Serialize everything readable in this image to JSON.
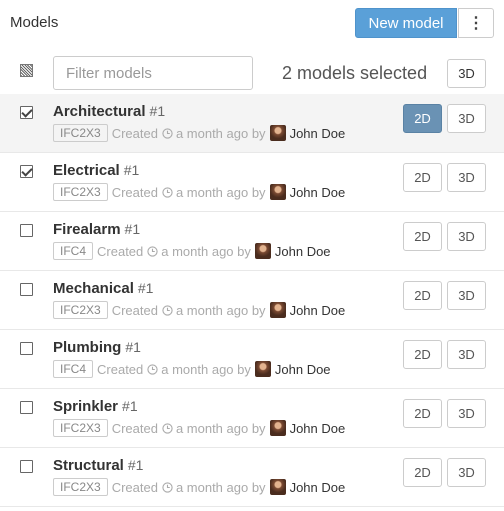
{
  "header": {
    "title": "Models",
    "new_model_label": "New model",
    "more_label": "⋮"
  },
  "toolbar": {
    "filter_placeholder": "Filter models",
    "selected_text": "2 models selected",
    "button_3d": "3D"
  },
  "meta": {
    "created_label": "Created",
    "time_label": "a month ago by",
    "author": "John Doe"
  },
  "models": [
    {
      "name": "Architectural",
      "num": "#1",
      "schema": "IFC2X3",
      "checked": true,
      "active2d": true,
      "btn2d": "2D",
      "btn3d": "3D"
    },
    {
      "name": "Electrical",
      "num": "#1",
      "schema": "IFC2X3",
      "checked": true,
      "active2d": false,
      "btn2d": "2D",
      "btn3d": "3D"
    },
    {
      "name": "Firealarm",
      "num": "#1",
      "schema": "IFC4",
      "checked": false,
      "active2d": false,
      "btn2d": "2D",
      "btn3d": "3D"
    },
    {
      "name": "Mechanical",
      "num": "#1",
      "schema": "IFC2X3",
      "checked": false,
      "active2d": false,
      "btn2d": "2D",
      "btn3d": "3D"
    },
    {
      "name": "Plumbing",
      "num": "#1",
      "schema": "IFC4",
      "checked": false,
      "active2d": false,
      "btn2d": "2D",
      "btn3d": "3D"
    },
    {
      "name": "Sprinkler",
      "num": "#1",
      "schema": "IFC2X3",
      "checked": false,
      "active2d": false,
      "btn2d": "2D",
      "btn3d": "3D"
    },
    {
      "name": "Structural",
      "num": "#1",
      "schema": "IFC2X3",
      "checked": false,
      "active2d": false,
      "btn2d": "2D",
      "btn3d": "3D"
    }
  ],
  "colors": {
    "primary": "#5aa0d8",
    "active_2d": "#6a92b4",
    "selected_row": "#f4f4f4"
  }
}
